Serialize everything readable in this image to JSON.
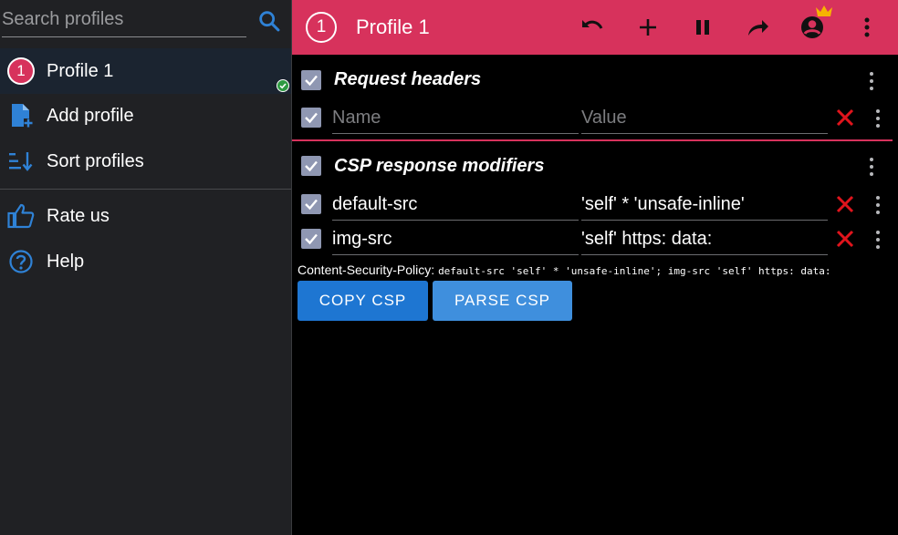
{
  "sidebar": {
    "search": {
      "placeholder": "Search profiles",
      "value": ""
    },
    "profiles": [
      {
        "badge": "1",
        "label": "Profile 1",
        "status": "active"
      }
    ],
    "actions": [
      {
        "label": "Add profile",
        "icon": "add-file-icon"
      },
      {
        "label": "Sort profiles",
        "icon": "sort-icon"
      }
    ],
    "links": [
      {
        "label": "Rate us",
        "icon": "thumb-up-icon"
      },
      {
        "label": "Help",
        "icon": "help-icon"
      }
    ]
  },
  "topbar": {
    "badge": "1",
    "title": "Profile 1",
    "buttons": [
      "undo-icon",
      "add-icon",
      "pause-icon",
      "share-icon",
      "account-icon",
      "more-icon"
    ]
  },
  "request_headers": {
    "title": "Request headers",
    "rows": [
      {
        "name_placeholder": "Name",
        "value_placeholder": "Value",
        "name": "",
        "value": ""
      }
    ]
  },
  "csp": {
    "title": "CSP response modifiers",
    "rows": [
      {
        "name": "default-src",
        "value": "'self' * 'unsafe-inline'"
      },
      {
        "name": "img-src",
        "value": "'self' https: data:"
      }
    ],
    "policy_label": "Content-Security-Policy:",
    "policy_value": "default-src 'self' * 'unsafe-inline'; img-src 'self' https: data:",
    "copy_button": "COPY CSP",
    "parse_button": "PARSE CSP"
  },
  "colors": {
    "accent": "#d7325c",
    "primary_button": "#1e76d2",
    "secondary_button": "#3f8fdd",
    "checkbox": "#8f97b2",
    "delete": "#e0141c"
  }
}
